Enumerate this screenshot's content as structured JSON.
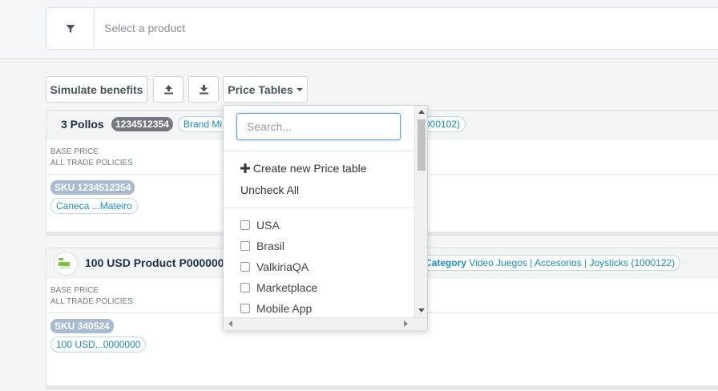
{
  "search": {
    "placeholder": "Select a product",
    "filter_icon": "filter-icon"
  },
  "toolbar": {
    "simulate_label": "Simulate benefits",
    "upload_icon": "upload-icon",
    "download_icon": "download-icon",
    "price_tables_label": "Price Tables"
  },
  "products": [
    {
      "title": "3 Pollos",
      "id_badge": "1234512354",
      "brand_pill": "Brand Mi",
      "category_pill_tail": "000102)",
      "base_price": "BASE PRICE",
      "trade_policies": "ALL TRADE POLICIES",
      "sku": "SKU 1234512354",
      "sku_name": "Caneca ...Mateiro"
    },
    {
      "title": "100 USD Product P000000",
      "category_label": "Category",
      "category_value": "Video Juegos | Accesorios | Joysticks (1000122)",
      "base_price": "BASE PRICE",
      "trade_policies": "ALL TRADE POLICIES",
      "sku": "SKU 340524",
      "sku_name": "100 USD...0000000"
    }
  ],
  "dropdown": {
    "search_placeholder": "Search...",
    "create_label": "Create new Price table",
    "uncheck_label": "Uncheck All",
    "options": [
      "USA",
      "Brasil",
      "ValkiriaQA",
      "Marketplace",
      "Mobile App"
    ]
  },
  "colors": {
    "accent": "#1a8cc9",
    "title": "#1d2e4a",
    "badge": "#737a80",
    "sku_badge": "#a9bbd1"
  }
}
